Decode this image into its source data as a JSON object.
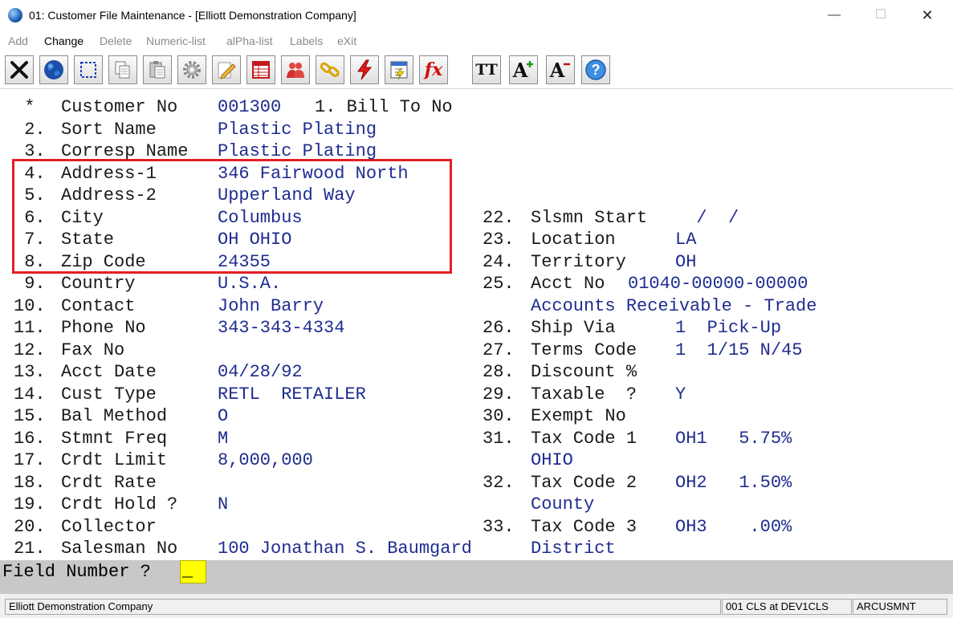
{
  "window": {
    "title": "01: Customer File Maintenance - [Elliott Demonstration Company]",
    "minimize": "—",
    "maximize": "☐",
    "close": "✕"
  },
  "menu": [
    {
      "label": "Add",
      "active": false
    },
    {
      "label": "Change",
      "active": true
    },
    {
      "label": "Delete",
      "active": false
    },
    {
      "label": "Numeric-list",
      "active": false
    },
    {
      "label": "alPha-list",
      "active": false
    },
    {
      "label": "Labels",
      "active": false
    },
    {
      "label": "eXit",
      "active": false
    }
  ],
  "toolbar": {
    "icons": [
      "exit-x-icon",
      "globe-icon",
      "select-box-icon",
      "copy-icon",
      "paste-icon",
      "settings-gear-icon",
      "edit-pencil-icon",
      "spreadsheet-icon",
      "users-icon",
      "link-chain-icon",
      "lightning-icon",
      "calculator-icon",
      "function-fx-icon",
      "font-tt-icon",
      "font-increase-icon",
      "font-decrease-icon",
      "help-icon"
    ],
    "fx_text": "fx",
    "tt_text": "TT",
    "font_up_text": "A",
    "font_down_text": "A",
    "help_text": "?"
  },
  "fields": {
    "customer_no": {
      "num": " *",
      "label": "Customer No",
      "value": "001300"
    },
    "bill_to": {
      "label": "1. Bill To No",
      "value": ""
    },
    "left": [
      {
        "num": " 2.",
        "label": "Sort Name",
        "value": "Plastic Plating"
      },
      {
        "num": " 3.",
        "label": "Corresp Name",
        "value": "Plastic Plating"
      },
      {
        "num": " 4.",
        "label": "Address-1",
        "value": "346 Fairwood North"
      },
      {
        "num": " 5.",
        "label": "Address-2",
        "value": "Upperland Way"
      },
      {
        "num": " 6.",
        "label": "City",
        "value": "Columbus"
      },
      {
        "num": " 7.",
        "label": "State",
        "value": "OH OHIO"
      },
      {
        "num": " 8.",
        "label": "Zip Code",
        "value": "24355"
      },
      {
        "num": " 9.",
        "label": "Country",
        "value": "U.S.A."
      },
      {
        "num": "10.",
        "label": "Contact",
        "value": "John Barry"
      },
      {
        "num": "11.",
        "label": "Phone No",
        "value": "343-343-4334"
      },
      {
        "num": "12.",
        "label": "Fax No",
        "value": ""
      },
      {
        "num": "13.",
        "label": "Acct Date",
        "value": "04/28/92"
      },
      {
        "num": "14.",
        "label": "Cust Type",
        "value": "RETL  RETAILER"
      },
      {
        "num": "15.",
        "label": "Bal Method",
        "value": "O"
      },
      {
        "num": "16.",
        "label": "Stmnt Freq",
        "value": "M"
      },
      {
        "num": "17.",
        "label": "Crdt Limit",
        "value": "8,000,000"
      },
      {
        "num": "18.",
        "label": "Crdt Rate",
        "value": ""
      },
      {
        "num": "19.",
        "label": "Crdt Hold ?",
        "value": "N"
      },
      {
        "num": "20.",
        "label": "Collector",
        "value": ""
      },
      {
        "num": "21.",
        "label": "Salesman No",
        "value": "100 Jonathan S. Baumgard"
      }
    ],
    "right": [
      {
        "num": "22.",
        "label": "Slsmn Start",
        "value": "  /  /"
      },
      {
        "num": "23.",
        "label": "Location",
        "value": "LA"
      },
      {
        "num": "24.",
        "label": "Territory",
        "value": "OH"
      },
      {
        "num": "25.",
        "label": "Acct No",
        "value": "01040-00000-00000"
      },
      {
        "num": "",
        "label": "",
        "value": "Accounts Receivable - Trade"
      },
      {
        "num": "26.",
        "label": "Ship Via",
        "value": "1  Pick-Up"
      },
      {
        "num": "27.",
        "label": "Terms Code",
        "value": "1  1/15 N/45"
      },
      {
        "num": "28.",
        "label": "Discount %",
        "value": ""
      },
      {
        "num": "29.",
        "label": "Taxable  ?",
        "value": "Y"
      },
      {
        "num": "30.",
        "label": "Exempt No",
        "value": ""
      },
      {
        "num": "31.",
        "label": "Tax Code 1",
        "value": "OH1   5.75%"
      },
      {
        "num": "",
        "label": "",
        "value": "OHIO"
      },
      {
        "num": "32.",
        "label": "Tax Code 2",
        "value": "OH2   1.50%"
      },
      {
        "num": "",
        "label": "",
        "value": "County"
      },
      {
        "num": "33.",
        "label": "Tax Code 3",
        "value": "OH3    .00%"
      },
      {
        "num": "",
        "label": "",
        "value": "District"
      }
    ]
  },
  "prompt": {
    "label": "Field Number ?",
    "value": "_"
  },
  "status": {
    "company": "Elliott Demonstration Company",
    "session": "001 CLS at DEV1CLS",
    "program": "ARCUSMNT"
  },
  "colors": {
    "highlight_box": "#e21f26",
    "field_value": "#1f2d8f",
    "prompt_input": "#ffff00"
  }
}
